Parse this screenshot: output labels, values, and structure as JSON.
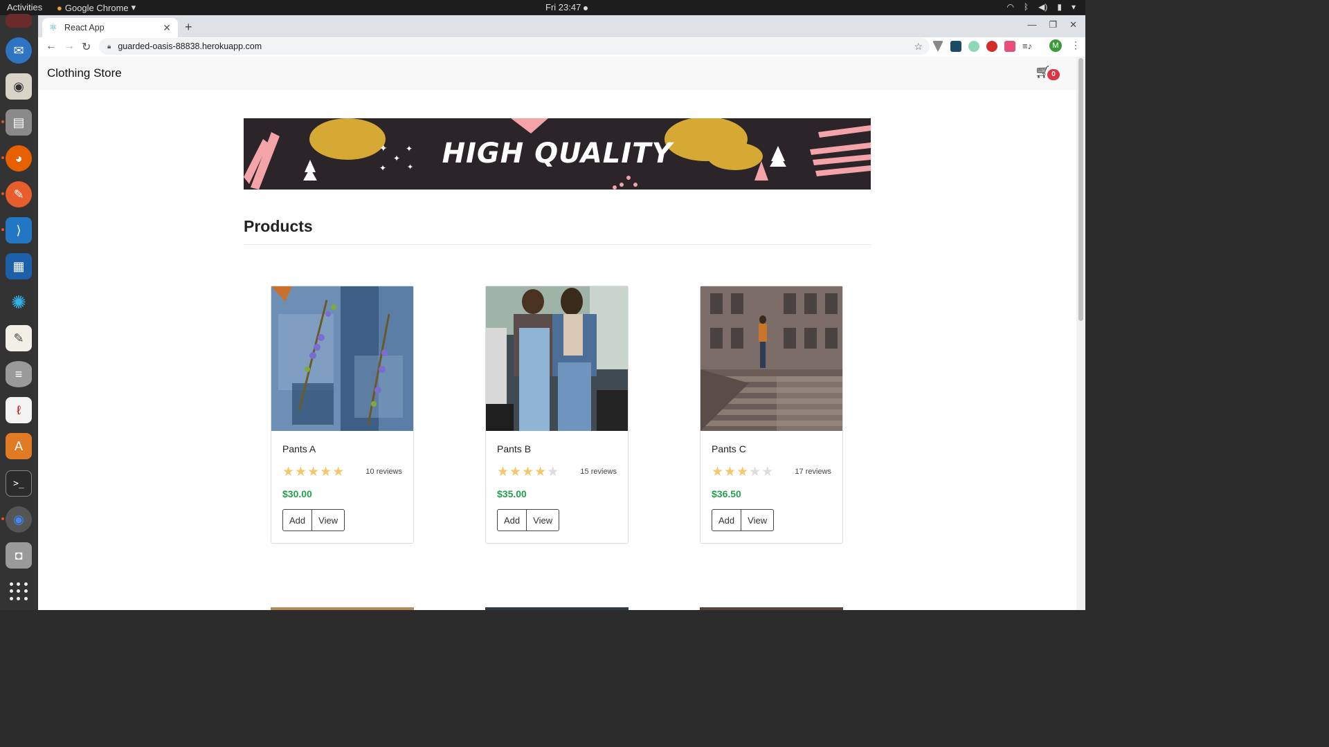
{
  "os": {
    "activities": "Activities",
    "app_name": "Google Chrome",
    "clock": "Fri 23:47"
  },
  "browser": {
    "tab_title": "React App",
    "url": "guarded-oasis-88838.herokuapp.com",
    "profile_initial": "M"
  },
  "navbar": {
    "brand": "Clothing Store",
    "cart_count": "0"
  },
  "banner": {
    "text": "HIGH QUALITY"
  },
  "section": {
    "title": "Products"
  },
  "products": [
    {
      "name": "Pants A",
      "rating": 5,
      "reviews": "10 reviews",
      "price": "$30.00",
      "add_label": "Add",
      "view_label": "View"
    },
    {
      "name": "Pants B",
      "rating": 4,
      "reviews": "15 reviews",
      "price": "$35.00",
      "add_label": "Add",
      "view_label": "View"
    },
    {
      "name": "Pants C",
      "rating": 3,
      "reviews": "17 reviews",
      "price": "$36.50",
      "add_label": "Add",
      "view_label": "View"
    }
  ],
  "colors": {
    "price": "#22a04b",
    "star_on": "#f5c76b",
    "badge": "#dc3545",
    "banner_bg": "#2b2428"
  }
}
